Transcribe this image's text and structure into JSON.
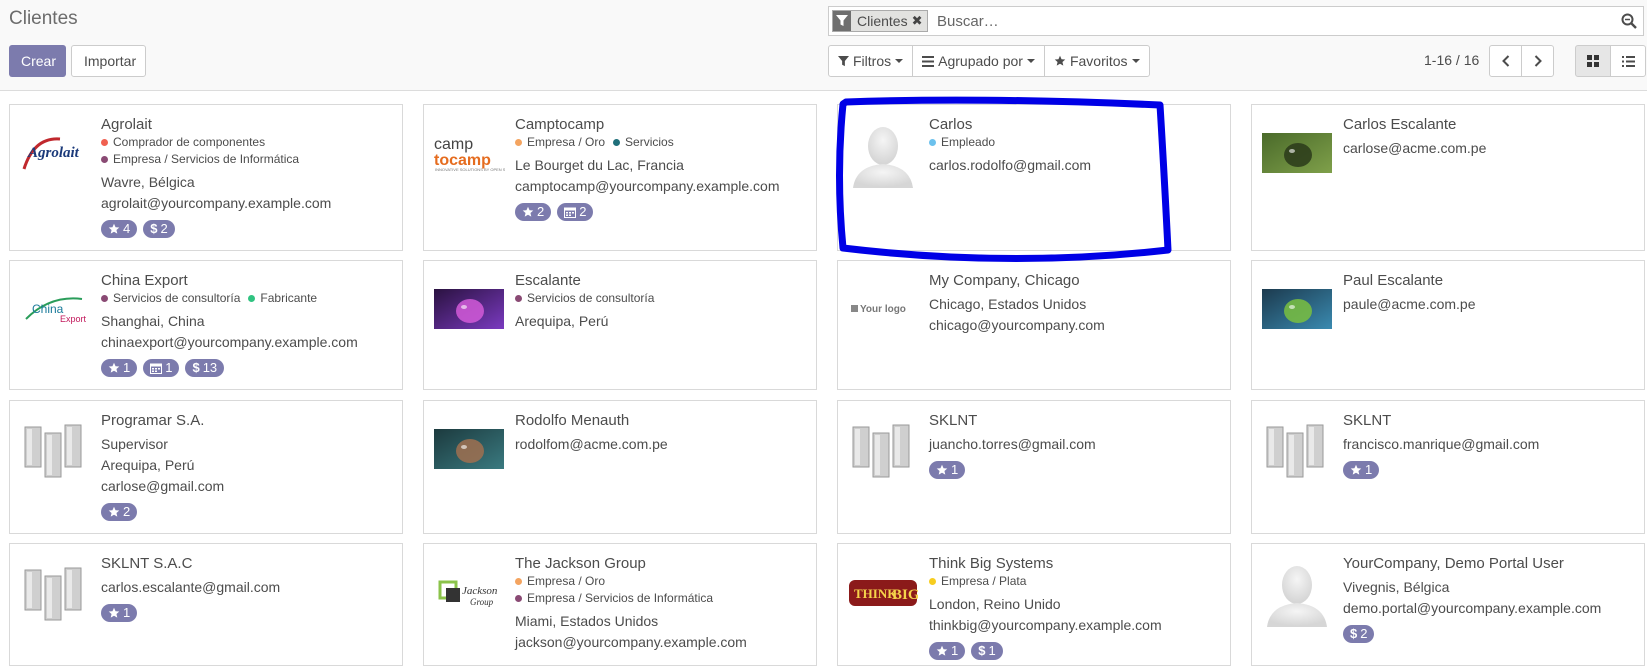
{
  "header": {
    "title": "Clientes",
    "create_label": "Crear",
    "import_label": "Importar"
  },
  "search": {
    "facet_label": "Clientes",
    "placeholder": "Buscar…"
  },
  "filters": {
    "filter_label": "Filtros",
    "group_label": "Agrupado por",
    "favorites_label": "Favoritos"
  },
  "pager": {
    "value": "1-16 / 16"
  },
  "colors": {
    "primary": "#7c7bad",
    "annotation": "#0000e6"
  },
  "cards": [
    {
      "name": "Agrolait",
      "logo": "agrolait-logo",
      "tags": [
        {
          "label": "Comprador de componentes",
          "color": "#f06050"
        },
        {
          "label": "Empresa / Servicios de Informática",
          "color": "#8a4a74"
        }
      ],
      "lines": [
        "Wavre, Bélgica",
        "agrolait@yourcompany.example.com"
      ],
      "badges": [
        {
          "icon": "star",
          "value": "4"
        },
        {
          "icon": "dollar",
          "value": "2"
        }
      ]
    },
    {
      "name": "Camptocamp",
      "logo": "camptocamp-logo",
      "tags": [
        {
          "label": "Empresa / Oro",
          "color": "#f4a460"
        },
        {
          "label": "Servicios",
          "color": "#1f6f7a"
        }
      ],
      "lines": [
        "Le Bourget du Lac, Francia",
        "camptocamp@yourcompany.example.com"
      ],
      "badges": [
        {
          "icon": "star",
          "value": "2"
        },
        {
          "icon": "calendar",
          "value": "2"
        }
      ]
    },
    {
      "name": "Carlos",
      "logo": "avatar",
      "tags": [
        {
          "label": "Empleado",
          "color": "#6cc1ed"
        }
      ],
      "lines": [
        "carlos.rodolfo@gmail.com"
      ],
      "badges": []
    },
    {
      "name": "Carlos Escalante",
      "logo": "photo-green",
      "tags": [],
      "lines": [
        "carlose@acme.com.pe"
      ],
      "badges": []
    },
    {
      "name": "China Export",
      "logo": "chinaexport-logo",
      "tags": [
        {
          "label": "Servicios de consultoría",
          "color": "#8a4a74"
        },
        {
          "label": "Fabricante",
          "color": "#30c381"
        }
      ],
      "lines": [
        "Shanghai, China",
        "chinaexport@yourcompany.example.com"
      ],
      "badges": [
        {
          "icon": "star",
          "value": "1"
        },
        {
          "icon": "calendar",
          "value": "1"
        },
        {
          "icon": "dollar",
          "value": "13"
        }
      ]
    },
    {
      "name": "Escalante",
      "logo": "photo-purple",
      "tags": [
        {
          "label": "Servicios de consultoría",
          "color": "#8a4a74"
        }
      ],
      "lines": [
        "Arequipa, Perú"
      ],
      "badges": []
    },
    {
      "name": "My Company, Chicago",
      "logo": "yourlogo",
      "tags": [],
      "lines": [
        "Chicago, Estados Unidos",
        "chicago@yourcompany.com"
      ],
      "badges": []
    },
    {
      "name": "Paul Escalante",
      "logo": "photo-blue",
      "tags": [],
      "lines": [
        "paule@acme.com.pe"
      ],
      "badges": []
    },
    {
      "name": "Programar S.A.",
      "logo": "buildings",
      "tags": [],
      "lines": [
        "Supervisor",
        "Arequipa, Perú",
        "carlose@gmail.com"
      ],
      "badges": [
        {
          "icon": "star",
          "value": "2"
        }
      ]
    },
    {
      "name": "Rodolfo Menauth",
      "logo": "photo-teal",
      "tags": [],
      "lines": [
        "rodolfom@acme.com.pe"
      ],
      "badges": []
    },
    {
      "name": "SKLNT",
      "logo": "buildings",
      "tags": [],
      "lines": [
        "juancho.torres@gmail.com"
      ],
      "badges": [
        {
          "icon": "star",
          "value": "1"
        }
      ]
    },
    {
      "name": "SKLNT",
      "logo": "buildings",
      "tags": [],
      "lines": [
        "francisco.manrique@gmail.com"
      ],
      "badges": [
        {
          "icon": "star",
          "value": "1"
        }
      ]
    },
    {
      "name": "SKLNT S.A.C",
      "logo": "buildings",
      "tags": [],
      "lines": [
        "carlos.escalante@gmail.com"
      ],
      "badges": [
        {
          "icon": "star",
          "value": "1"
        }
      ]
    },
    {
      "name": "The Jackson Group",
      "logo": "jackson-logo",
      "tags": [
        {
          "label": "Empresa / Oro",
          "color": "#f4a460"
        },
        {
          "label": "Empresa / Servicios de Informática",
          "color": "#8a4a74"
        }
      ],
      "lines": [
        "Miami, Estados Unidos",
        "jackson@yourcompany.example.com"
      ],
      "badges": []
    },
    {
      "name": "Think Big Systems",
      "logo": "thinkbig-logo",
      "tags": [
        {
          "label": "Empresa / Plata",
          "color": "#f7cd1f"
        }
      ],
      "lines": [
        "London, Reino Unido",
        "thinkbig@yourcompany.example.com"
      ],
      "badges": [
        {
          "icon": "star",
          "value": "1"
        },
        {
          "icon": "dollar",
          "value": "1"
        }
      ]
    },
    {
      "name": "YourCompany, Demo Portal User",
      "logo": "avatar",
      "tags": [],
      "lines": [
        "Vivegnis, Bélgica",
        "demo.portal@yourcompany.example.com"
      ],
      "badges": [
        {
          "icon": "dollar",
          "value": "2"
        }
      ]
    }
  ]
}
